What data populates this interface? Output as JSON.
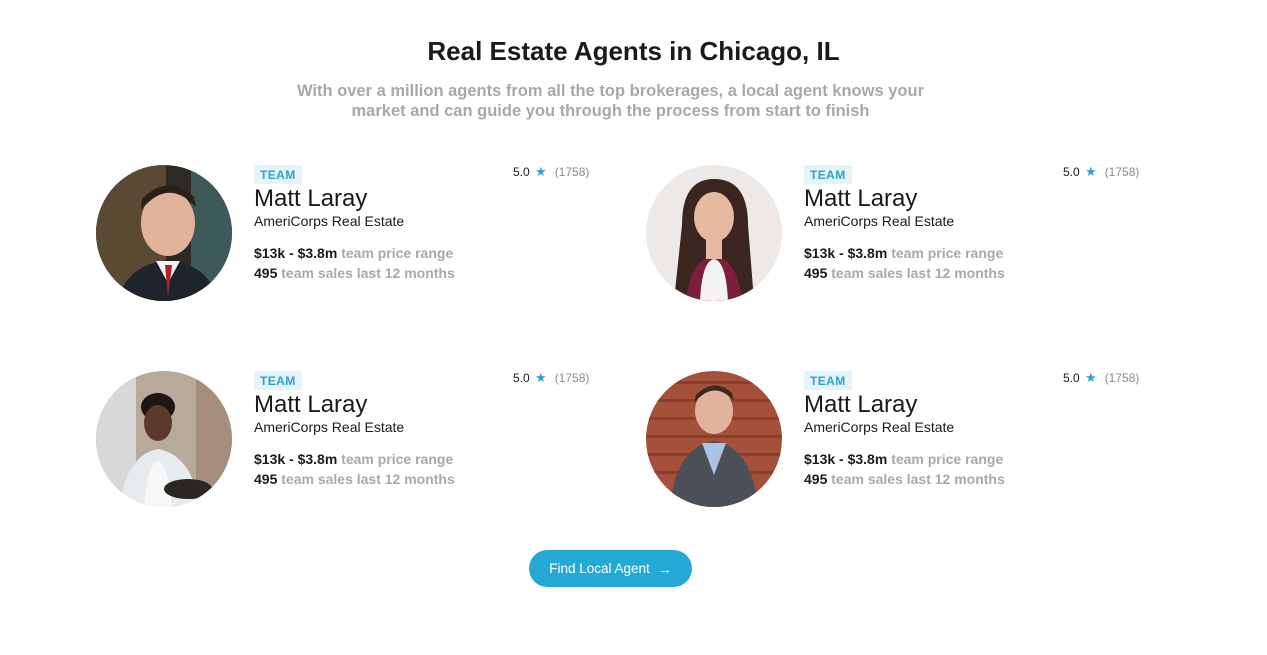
{
  "header": {
    "title": "Real Estate Agents in Chicago, IL",
    "subtitle": "With over a million agents from all the top brokerages, a local agent knows your market and can guide you through the process from start to finish"
  },
  "agents": [
    {
      "badge": "TEAM",
      "name": "Matt Laray",
      "company": "AmeriCorps Real Estate",
      "rating": "5.0",
      "reviews": "(1758)",
      "price_range": "$13k - $3.8m",
      "price_label": "team price range",
      "sales_count": "495",
      "sales_label": "team sales last 12 months"
    },
    {
      "badge": "TEAM",
      "name": "Matt Laray",
      "company": "AmeriCorps Real Estate",
      "rating": "5.0",
      "reviews": "(1758)",
      "price_range": "$13k - $3.8m",
      "price_label": "team price range",
      "sales_count": "495",
      "sales_label": "team sales last 12 months"
    },
    {
      "badge": "TEAM",
      "name": "Matt Laray",
      "company": "AmeriCorps Real Estate",
      "rating": "5.0",
      "reviews": "(1758)",
      "price_range": "$13k - $3.8m",
      "price_label": "team price range",
      "sales_count": "495",
      "sales_label": "team sales last 12 months"
    },
    {
      "badge": "TEAM",
      "name": "Matt Laray",
      "company": "AmeriCorps Real Estate",
      "rating": "5.0",
      "reviews": "(1758)",
      "price_range": "$13k - $3.8m",
      "price_label": "team price range",
      "sales_count": "495",
      "sales_label": "team sales last 12 months"
    }
  ],
  "cta": {
    "label": "Find Local Agent",
    "icon": "arrow-right-icon"
  },
  "colors": {
    "accent": "#24a9d6",
    "badge_bg": "#e5f3fa",
    "muted_text": "#a9a9a9"
  }
}
